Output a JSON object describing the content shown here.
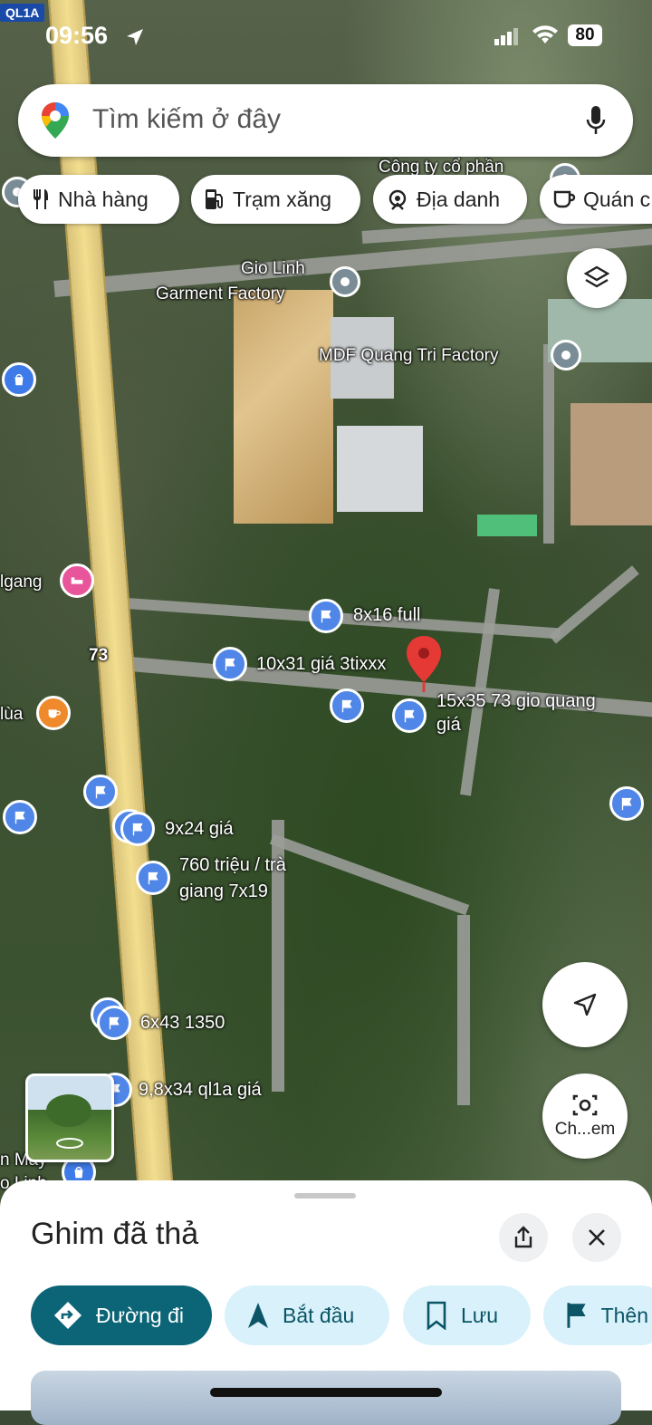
{
  "status_bar": {
    "time": "09:56",
    "battery": "80"
  },
  "road_shield": "QL1A",
  "search": {
    "placeholder": "Tìm kiếm ở đây"
  },
  "chips": [
    {
      "label": "Nhà hàng",
      "icon": "fork-knife-icon"
    },
    {
      "label": "Trạm xăng",
      "icon": "gas-station-icon"
    },
    {
      "label": "Địa danh",
      "icon": "landmark-icon"
    },
    {
      "label": "Quán c",
      "icon": "coffee-cup-icon"
    }
  ],
  "map_labels": {
    "company_top": "Công ty cổ phần",
    "gio_linh_1": "Gio Linh",
    "gio_linh_2": "Garment Factory",
    "mdf": "MDF Quang Tri Factory",
    "road_73": "73",
    "left_igang": "lgang",
    "left_lua": "lùa",
    "left_may": "n May",
    "left_linh": "o Linh"
  },
  "listings": {
    "l1": "8x16 full",
    "l2": "10x31 giá 3tixxx",
    "l3a": "15x35 73 gio quang",
    "l3b": "giá",
    "l4": "9x24 giá",
    "l5a": "760 triệu / trà",
    "l5b": "giang 7x19",
    "l6": "6x43 1350",
    "l7": "9,8x34 ql1a giá"
  },
  "lens_button": "Ch...em",
  "sheet": {
    "title": "Ghim đã thả",
    "actions": [
      {
        "label": "Đường đi"
      },
      {
        "label": "Bắt đầu"
      },
      {
        "label": "Lưu"
      },
      {
        "label": "Thên"
      }
    ]
  },
  "colors": {
    "accent": "#0b6577",
    "pin": "#e53935",
    "flag": "#4f86e8"
  }
}
